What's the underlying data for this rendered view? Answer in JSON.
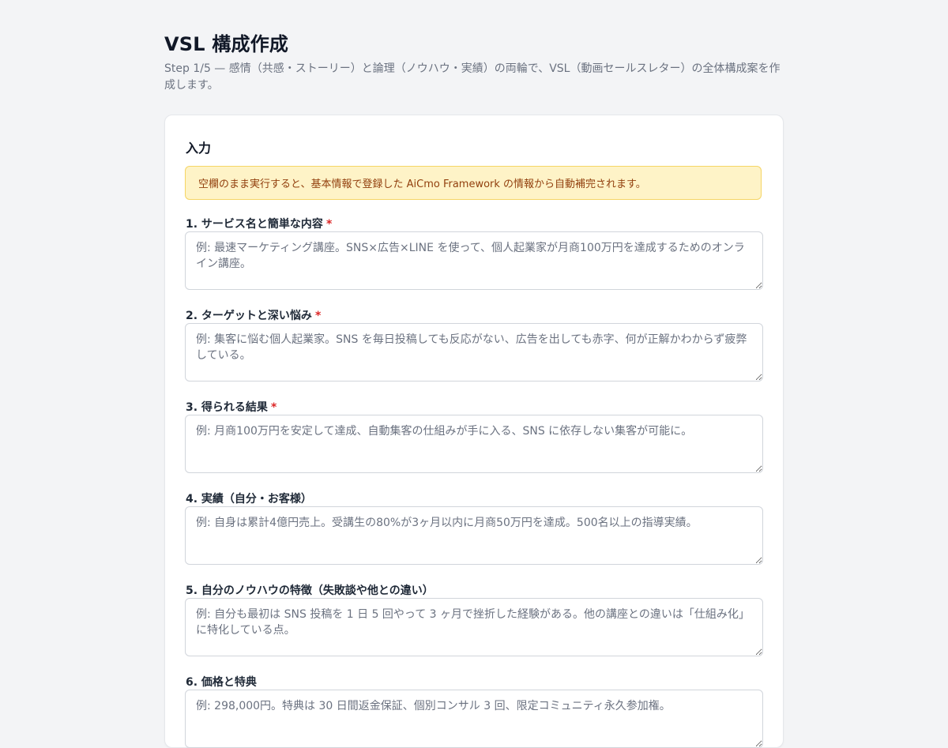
{
  "page": {
    "title": "VSL 構成作成",
    "subtitle": "Step 1/5 — 感情（共感・ストーリー）と論理（ノウハウ・実績）の両輪で、VSL（動画セールスレター）の全体構成案を作成します。"
  },
  "card": {
    "title": "入力",
    "notice": "空欄のまま実行すると、基本情報で登録した AiCmo Framework の情報から自動補完されます。"
  },
  "fields": [
    {
      "label": "1. サービス名と簡単な内容",
      "required_mark": "*",
      "placeholder": "例: 最速マーケティング講座。SNS×広告×LINE を使って、個人起業家が月商100万円を達成するためのオンライン講座。"
    },
    {
      "label": "2. ターゲットと深い悩み",
      "required_mark": "*",
      "placeholder": "例: 集客に悩む個人起業家。SNS を毎日投稿しても反応がない、広告を出しても赤字、何が正解かわからず疲弊している。"
    },
    {
      "label": "3. 得られる結果",
      "required_mark": "*",
      "placeholder": "例: 月商100万円を安定して達成、自動集客の仕組みが手に入る、SNS に依存しない集客が可能に。"
    },
    {
      "label": "4. 実績（自分・お客様）",
      "placeholder": "例: 自身は累計4億円売上。受講生の80%が3ヶ月以内に月商50万円を達成。500名以上の指導実績。"
    },
    {
      "label": "5. 自分のノウハウの特徴（失敗談や他との違い）",
      "placeholder": "例: 自分も最初は SNS 投稿を 1 日 5 回やって 3 ヶ月で挫折した経験がある。他の講座との違いは「仕組み化」に特化している点。"
    },
    {
      "label": "6. 価格と特典",
      "placeholder": "例: 298,000円。特典は 30 日間返金保証、個別コンサル 3 回、限定コミュニティ永久参加権。"
    }
  ]
}
